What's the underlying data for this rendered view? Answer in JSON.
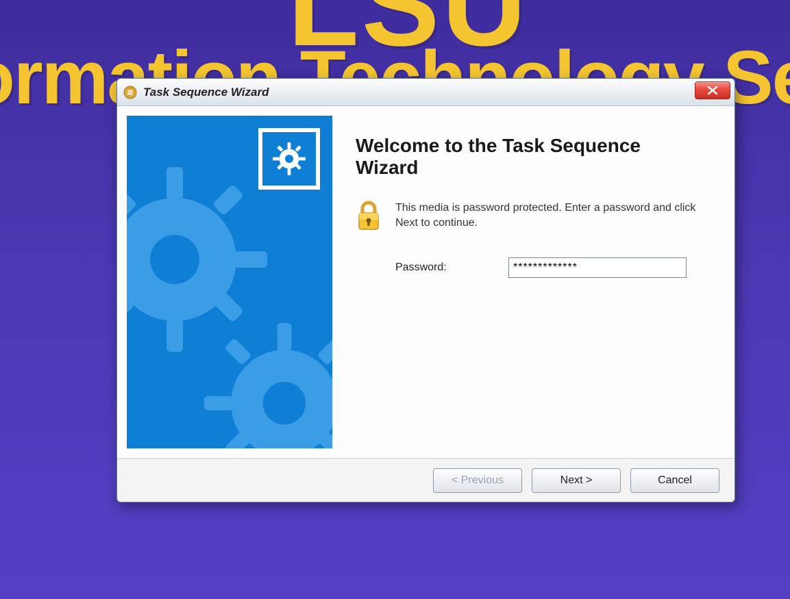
{
  "background": {
    "logo_top": "LSU",
    "subtitle": "formation Technology Ser"
  },
  "window": {
    "title": "Task Sequence Wizard"
  },
  "content": {
    "heading": "Welcome to the Task Sequence Wizard",
    "info_text": "This media is password protected.  Enter a password and click Next to continue.",
    "password_label": "Password:",
    "password_value": "*************"
  },
  "buttons": {
    "previous": "< Previous",
    "next": "Next >",
    "cancel": "Cancel"
  }
}
